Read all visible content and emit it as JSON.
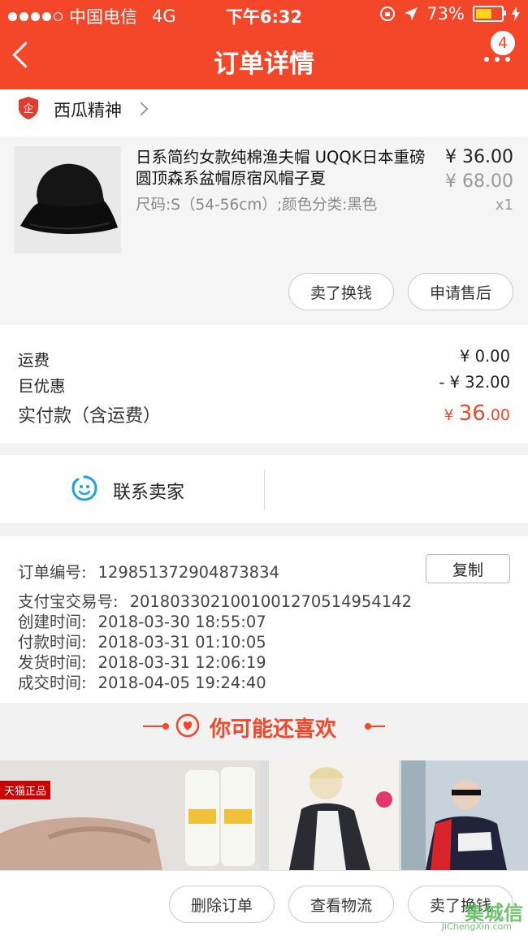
{
  "status_bar": {
    "carrier": "中国电信",
    "network": "4G",
    "time": "下午6:32",
    "battery": "73%",
    "battery_level": 0.73
  },
  "nav": {
    "title": "订单详情",
    "badge_count": "4"
  },
  "store": {
    "badge_char": "企",
    "name": "西瓜精神"
  },
  "product": {
    "title": "日系简约女款纯棉渔夫帽 UQQK日本重磅圆顶森系盆帽原宿风帽子夏",
    "spec": "尺码:S（54-56cm）;颜色分类:黑色",
    "price": "¥ 36.00",
    "original_price": "¥ 68.00",
    "quantity": "x1",
    "actions": [
      "卖了换钱",
      "申请售后"
    ]
  },
  "fees": {
    "shipping_label": "运费",
    "shipping_value": "¥ 0.00",
    "discount_label": "巨优惠",
    "discount_value": "- ¥ 32.00",
    "paid_label": "实付款（含运费）",
    "paid_currency": "¥ ",
    "paid_int": "36",
    "paid_dec": ".00"
  },
  "contact": {
    "label": "联系卖家"
  },
  "order_info": {
    "copy_label": "复制",
    "rows": [
      {
        "label": "订单编号:",
        "value": "129851372904873834"
      },
      {
        "label": "支付宝交易号:",
        "value": "2018033021001001270514954142"
      },
      {
        "label": "创建时间:",
        "value": "2018-03-30 18:55:07"
      },
      {
        "label": "付款时间:",
        "value": "2018-03-31 01:10:05"
      },
      {
        "label": "发货时间:",
        "value": "2018-03-31 12:06:19"
      },
      {
        "label": "成交时间:",
        "value": "2018-04-05 19:24:40"
      }
    ]
  },
  "recommend": {
    "title": "你可能还喜欢",
    "tile1_tag": "天猫正品"
  },
  "bottom_bar": {
    "buttons": [
      "删除订单",
      "查看物流",
      "卖了换钱"
    ]
  },
  "watermark": {
    "text": "集城信",
    "sub": "JiChengXin.com"
  },
  "colors": {
    "brand": "#f4472a",
    "contact_icon": "#1ea0e6"
  }
}
